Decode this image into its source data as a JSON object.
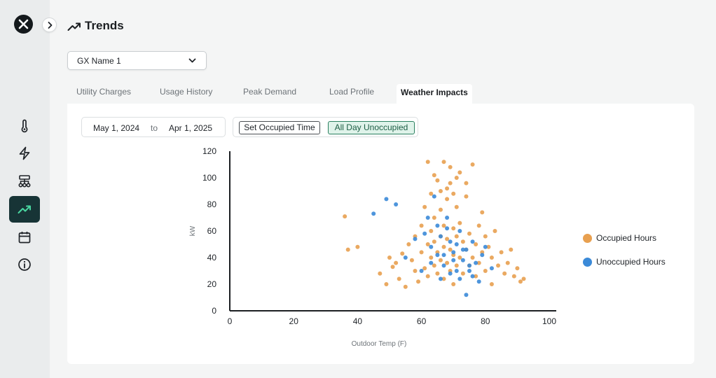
{
  "header": {
    "title": "Trends"
  },
  "site_select": {
    "value": "GX Name 1"
  },
  "tabs": [
    {
      "label": "Utility Charges"
    },
    {
      "label": "Usage History"
    },
    {
      "label": "Peak Demand"
    },
    {
      "label": "Load Profile"
    },
    {
      "label": "Weather Impacts"
    }
  ],
  "active_tab": "Weather Impacts",
  "date_range": {
    "start": "May 1, 2024",
    "separator": "to",
    "end": "Apr 1, 2025"
  },
  "mode": {
    "set_occupied": "Set Occupied Time",
    "all_day": "All Day Unoccupied"
  },
  "colors": {
    "occupied": "#e8a050",
    "unoccupied": "#3b8ad8",
    "accent": "#173436",
    "sidebar": "#eaeced"
  },
  "chart_data": {
    "type": "scatter",
    "xlabel": "Outdoor Temp (F)",
    "ylabel": "kW",
    "xlim": [
      0,
      100
    ],
    "ylim": [
      0,
      120
    ],
    "x_ticks": [
      "0",
      "20",
      "40",
      "60",
      "80",
      "100"
    ],
    "y_ticks": [
      "0",
      "20",
      "40",
      "60",
      "80",
      "100",
      "120"
    ],
    "legend_position": "right",
    "series": [
      {
        "name": "Occupied Hours",
        "color": "#e8a050",
        "x": [
          36,
          37,
          40,
          47,
          49,
          50,
          51,
          52,
          53,
          54,
          55,
          56,
          57,
          58,
          58,
          59,
          60,
          60,
          61,
          61,
          62,
          62,
          63,
          63,
          63,
          64,
          64,
          64,
          65,
          65,
          65,
          66,
          66,
          66,
          67,
          67,
          67,
          68,
          68,
          68,
          69,
          69,
          69,
          70,
          70,
          70,
          71,
          71,
          71,
          72,
          72,
          73,
          73,
          74,
          74,
          75,
          75,
          76,
          76,
          77,
          77,
          78,
          78,
          79,
          79,
          80,
          80,
          81,
          82,
          82,
          83,
          84,
          85,
          86,
          87,
          88,
          89,
          90,
          91,
          92,
          62,
          64,
          66,
          68,
          70,
          72,
          74,
          67,
          69,
          71
        ],
        "y": [
          71,
          46,
          48,
          28,
          20,
          40,
          33,
          36,
          24,
          43,
          18,
          50,
          38,
          30,
          56,
          22,
          44,
          64,
          32,
          78,
          50,
          26,
          40,
          60,
          88,
          34,
          52,
          70,
          44,
          28,
          98,
          38,
          56,
          76,
          24,
          48,
          64,
          36,
          54,
          84,
          30,
          46,
          108,
          42,
          62,
          20,
          34,
          56,
          78,
          40,
          66,
          28,
          52,
          46,
          96,
          34,
          58,
          40,
          110,
          26,
          50,
          64,
          36,
          44,
          74,
          30,
          56,
          48,
          40,
          20,
          60,
          34,
          44,
          28,
          36,
          46,
          26,
          32,
          22,
          24,
          112,
          102,
          90,
          92,
          88,
          104,
          86,
          112,
          96,
          100
        ]
      },
      {
        "name": "Unoccupied Hours",
        "color": "#3b8ad8",
        "x": [
          45,
          49,
          52,
          55,
          58,
          60,
          62,
          63,
          65,
          66,
          67,
          68,
          69,
          70,
          71,
          72,
          73,
          74,
          75,
          76,
          77,
          78,
          79,
          80,
          82,
          64,
          66,
          68,
          70,
          72,
          61,
          63,
          65,
          67,
          69,
          71,
          73,
          75,
          74,
          76
        ],
        "y": [
          73,
          84,
          80,
          40,
          54,
          30,
          70,
          48,
          42,
          56,
          34,
          62,
          28,
          44,
          50,
          24,
          38,
          46,
          30,
          52,
          36,
          22,
          42,
          48,
          32,
          86,
          24,
          70,
          38,
          60,
          58,
          36,
          64,
          42,
          52,
          30,
          46,
          34,
          12,
          26
        ]
      }
    ]
  }
}
